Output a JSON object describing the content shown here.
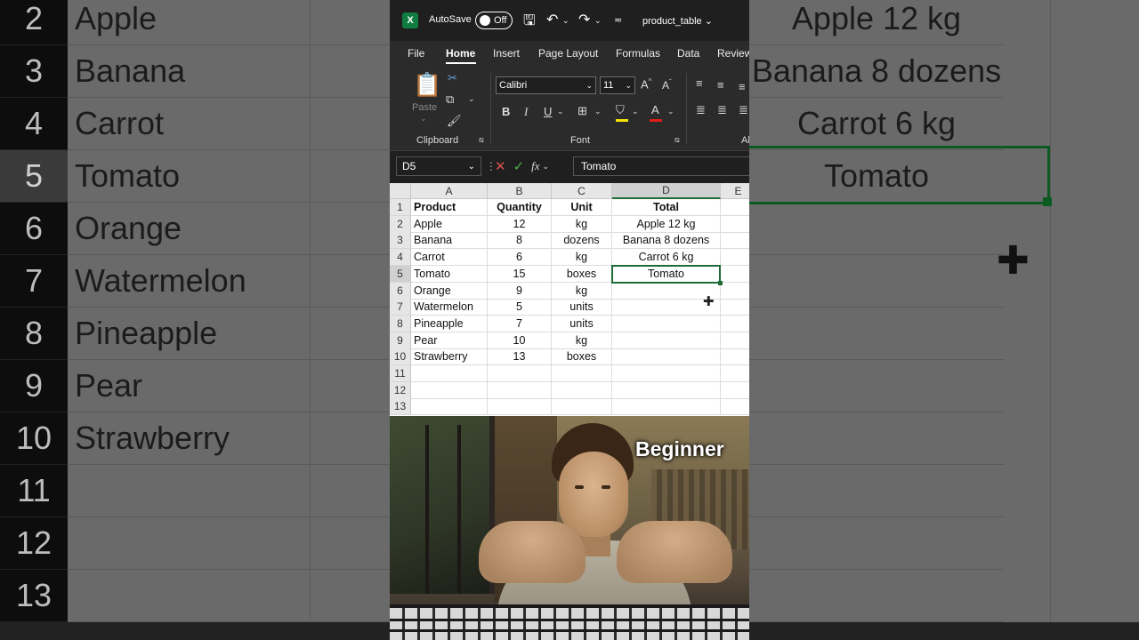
{
  "titlebar": {
    "app_icon": "excel-logo",
    "autosave_label": "AutoSave",
    "autosave_state": "Off",
    "doc_title": "product_table"
  },
  "tabs": [
    "File",
    "Home",
    "Insert",
    "Page Layout",
    "Formulas",
    "Data",
    "Review"
  ],
  "active_tab": "Home",
  "ribbon": {
    "paste_label": "Paste",
    "clipboard_group": "Clipboard",
    "font_name": "Calibri",
    "font_size": "11",
    "font_group": "Font",
    "alignment_group_partial": "Al",
    "bold": "B",
    "italic": "I",
    "underline": "U",
    "font_color_glyph": "A"
  },
  "formula_bar": {
    "name_box": "D5",
    "fx": "fx",
    "formula": "Tomato"
  },
  "sheet": {
    "columns": [
      "A",
      "B",
      "C",
      "D",
      "E"
    ],
    "selected_column": "D",
    "row_numbers": [
      "1",
      "2",
      "3",
      "4",
      "5",
      "6",
      "7",
      "8",
      "9",
      "10",
      "11",
      "12",
      "13"
    ],
    "selected_row": "5",
    "rows": [
      [
        "Product",
        "Quantity",
        "Unit",
        "Total"
      ],
      [
        "Apple",
        "12",
        "kg",
        "Apple 12 kg"
      ],
      [
        "Banana",
        "8",
        "dozens",
        "Banana 8 dozens"
      ],
      [
        "Carrot",
        "6",
        "kg",
        "Carrot 6 kg"
      ],
      [
        "Tomato",
        "15",
        "boxes",
        "Tomato"
      ],
      [
        "Orange",
        "9",
        "kg",
        ""
      ],
      [
        "Watermelon",
        "5",
        "units",
        ""
      ],
      [
        "Pineapple",
        "7",
        "units",
        ""
      ],
      [
        "Pear",
        "10",
        "kg",
        ""
      ],
      [
        "Strawberry",
        "13",
        "boxes",
        ""
      ],
      [
        "",
        "",
        "",
        ""
      ],
      [
        "",
        "",
        "",
        ""
      ],
      [
        "",
        "",
        "",
        ""
      ]
    ],
    "selected_cell": "D5"
  },
  "background": {
    "left_rows": [
      {
        "num": "2",
        "text": "Apple"
      },
      {
        "num": "3",
        "text": "Banana"
      },
      {
        "num": "4",
        "text": "Carrot"
      },
      {
        "num": "5",
        "text": "Tomato"
      },
      {
        "num": "6",
        "text": "Orange"
      },
      {
        "num": "7",
        "text": "Watermelon"
      },
      {
        "num": "8",
        "text": "Pineapple"
      },
      {
        "num": "9",
        "text": "Pear"
      },
      {
        "num": "10",
        "text": "Strawberry"
      },
      {
        "num": "11",
        "text": ""
      },
      {
        "num": "12",
        "text": ""
      },
      {
        "num": "13",
        "text": ""
      }
    ],
    "right_rows": [
      "Apple 12 kg",
      "Banana 8 dozens",
      "Carrot 6 kg",
      "Tomato"
    ]
  },
  "photo": {
    "caption": "Beginner"
  },
  "colors": {
    "excel_green": "#107c41",
    "selection_green": "#1e6b38",
    "ribbon_dark": "#2b2b2b"
  }
}
